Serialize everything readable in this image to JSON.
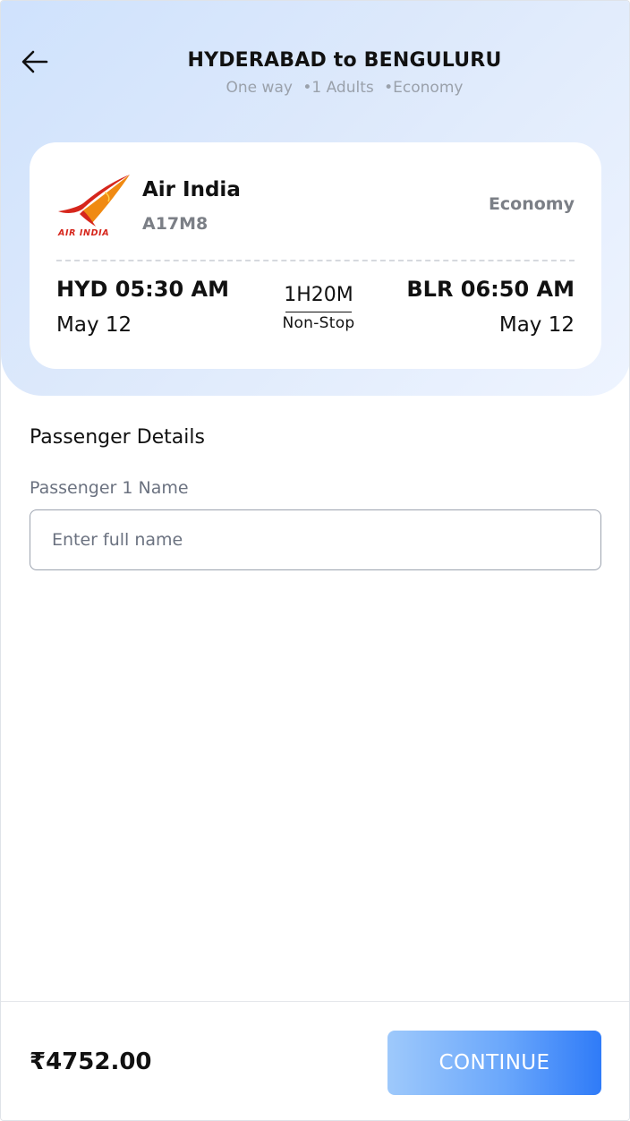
{
  "header": {
    "back_icon": "arrow-left-icon",
    "title": "HYDERABAD to BENGULURU",
    "trip_type": "One way",
    "passengers": "•1 Adults",
    "cabin": "•Economy"
  },
  "flight": {
    "airline_logo": "air-india-logo",
    "airline_logo_text": "AIR INDIA",
    "airline": "Air India",
    "flight_number": "A17M8",
    "cabin_class": "Economy",
    "departure_time": "HYD 05:30 AM",
    "departure_date": "May 12",
    "duration": "1H20M",
    "stops": "Non-Stop",
    "arrival_time": "BLR 06:50 AM",
    "arrival_date": "May 12"
  },
  "passenger": {
    "section_title": "Passenger Details",
    "name_label": "Passenger 1 Name",
    "name_placeholder": "Enter full name",
    "name_value": ""
  },
  "footer": {
    "price": "₹4752.00",
    "continue_label": "CONTINUE"
  },
  "colors": {
    "accent": "#2f7bf8",
    "accent_light": "#9ec9fb",
    "logo_red": "#d6261c",
    "logo_orange": "#f08a12"
  }
}
